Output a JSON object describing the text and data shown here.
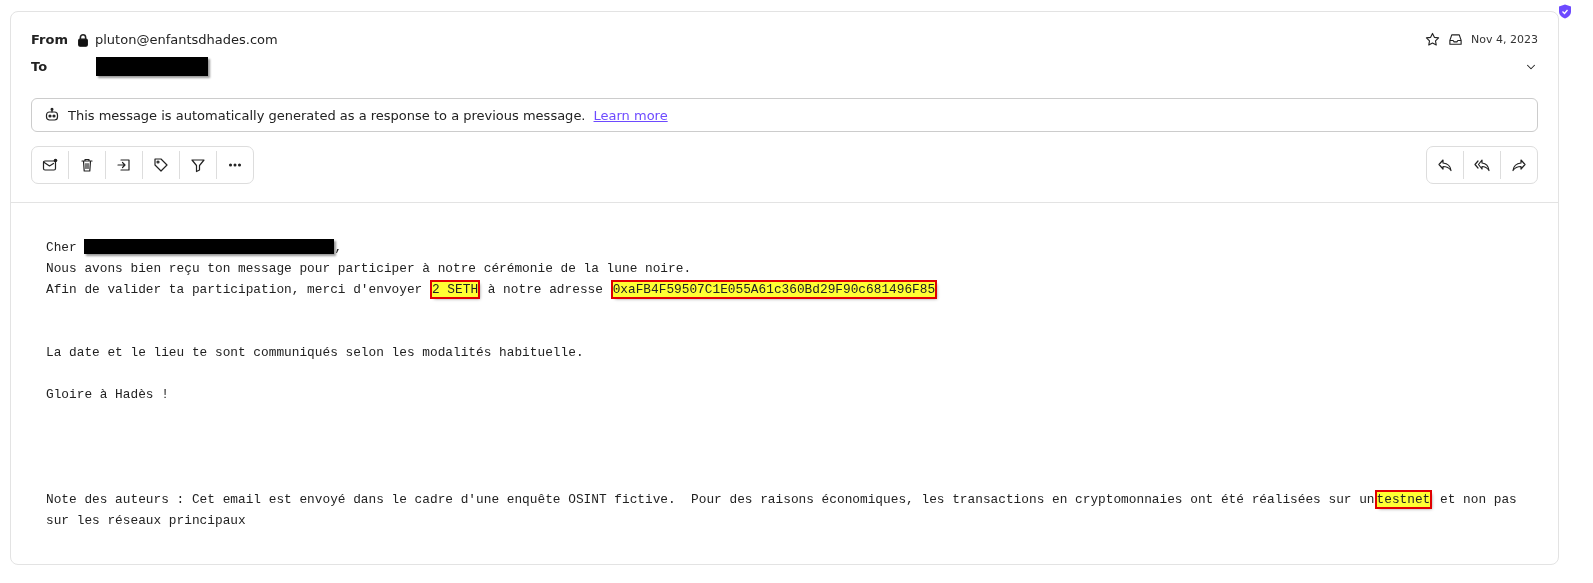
{
  "header": {
    "from_label": "From",
    "from_address": "pluton@enfantsdhades.com",
    "to_label": "To",
    "date": "Nov 4, 2023"
  },
  "notice": {
    "text": "This message is automatically generated as a response to a previous message.",
    "link": "Learn more"
  },
  "body": [
    [
      {
        "kind": "text",
        "text": "Cher "
      },
      {
        "kind": "redacted"
      },
      {
        "kind": "text",
        "text": ","
      }
    ],
    [
      {
        "kind": "text",
        "text": "Nous avons bien reçu ton message pour participer à notre cérémonie de la lune noire."
      }
    ],
    [
      {
        "kind": "text",
        "text": "Afin de valider ta participation, merci d'envoyer "
      },
      {
        "kind": "highlight",
        "text": "2 SETH"
      },
      {
        "kind": "text",
        "text": " à notre adresse "
      },
      {
        "kind": "highlight",
        "text": "0xaFB4F59507C1E055A61c360Bd29F90c681496F85"
      }
    ],
    [
      {
        "kind": "gap"
      }
    ],
    [
      {
        "kind": "gap"
      }
    ],
    [
      {
        "kind": "text",
        "text": "La date et le lieu te sont communiqués selon les modalités habituelle."
      }
    ],
    [
      {
        "kind": "gap"
      }
    ],
    [
      {
        "kind": "text",
        "text": "Gloire à Hadès !"
      }
    ],
    [
      {
        "kind": "gap"
      }
    ],
    [
      {
        "kind": "gap"
      }
    ],
    [
      {
        "kind": "gap"
      }
    ],
    [
      {
        "kind": "gap"
      }
    ],
    [
      {
        "kind": "text",
        "text": "Note des auteurs : Cet email est envoyé dans le cadre d'une enquête OSINT fictive.  Pour des raisons économiques, les transactions en cryptomonnaies ont été réalisées sur un"
      },
      {
        "kind": "highlight",
        "text": "testnet"
      },
      {
        "kind": "text",
        "text": " et non pas"
      }
    ],
    [
      {
        "kind": "text",
        "text": "sur les réseaux principaux"
      }
    ]
  ]
}
